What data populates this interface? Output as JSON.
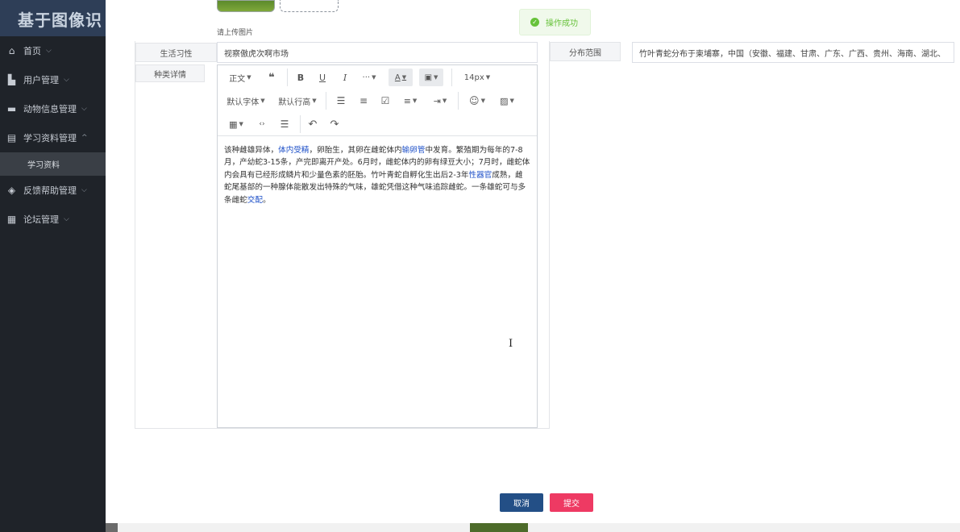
{
  "app": {
    "brand": "基于图像识"
  },
  "sidebar": {
    "items": [
      {
        "label": "首页",
        "icon": "home-icon"
      },
      {
        "label": "用户管理",
        "icon": "user-icon"
      },
      {
        "label": "动物信息管理",
        "icon": "animal-icon"
      },
      {
        "label": "学习资料管理",
        "icon": "book-icon",
        "expanded": true
      },
      {
        "label": "反馈帮助管理",
        "icon": "feedback-icon"
      },
      {
        "label": "论坛管理",
        "icon": "forum-icon"
      }
    ],
    "sub_item": "学习资料"
  },
  "upload": {
    "hint": "请上传图片"
  },
  "toast": {
    "message": "操作成功",
    "color": "#67c23a"
  },
  "form": {
    "habit_label": "生活习性",
    "habit_value": "视察傲虎次啊市场",
    "detail_label": "种类详情",
    "dist_label": "分布范围",
    "dist_value": "竹叶青蛇分布于柬埔寨，中国（安徽、福建、甘肃、广东、广西、贵州、海南、湖北、"
  },
  "editor": {
    "toolbar": {
      "heading": "正文",
      "more": "···",
      "font_size": "14px",
      "font_family": "默认字体",
      "line_height": "默认行高"
    },
    "content": {
      "p1": "该种雌雄异体，",
      "hl1": "体内受精",
      "p2": "，卵胎生，其卵在雌蛇体内",
      "hl2": "输卵管",
      "p3": "中发育。繁殖期为每年的7-8月，产幼蛇3-15条，产完即离开产处。6月时，雌蛇体内的卵有绿豆大小；7月时，雌蛇体内会具有已经形成鳞片和少量色素的胚胎。竹叶青蛇自孵化生出后2-3年",
      "hl3": "性器官",
      "p4": "成熟，雌蛇尾基部的一种腺体能散发出特殊的气味，雄蛇凭借这种气味追踪雌蛇。一条雄蛇可与多条雌蛇",
      "hl4": "交配",
      "p5": "。"
    }
  },
  "buttons": {
    "cancel": "取消",
    "submit": "提交"
  },
  "colors": {
    "cancel": "#234f86",
    "submit": "#ee3a63",
    "sidebar": "#1f2329"
  }
}
